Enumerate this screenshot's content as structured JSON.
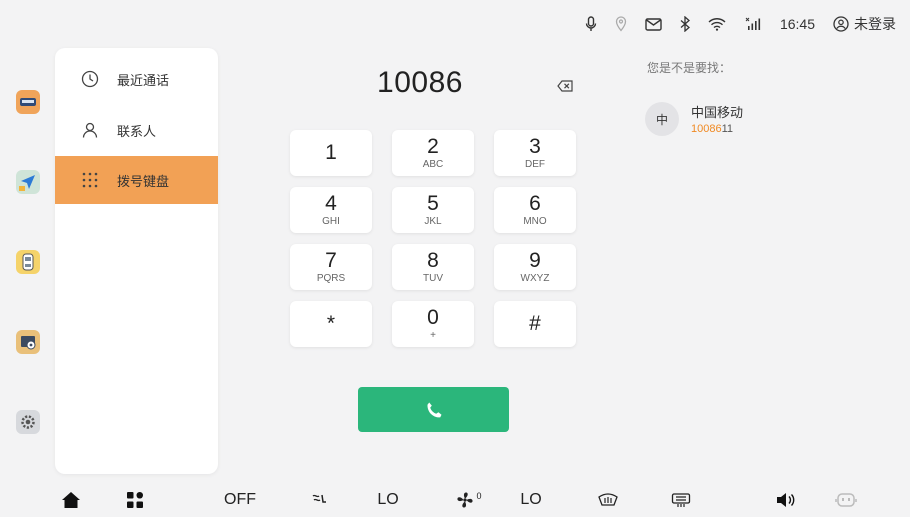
{
  "status_bar": {
    "time": "16:45",
    "user_label": "未登录",
    "icons": [
      "microphone-icon",
      "location-icon",
      "message-icon",
      "bluetooth-icon",
      "wifi-icon",
      "signal-icon",
      "user-icon"
    ]
  },
  "left_rail": {
    "apps": [
      "car-app-icon",
      "navigation-app-icon",
      "vehicle-app-icon",
      "media-app-icon",
      "settings-app-icon"
    ]
  },
  "sidebar": {
    "items": [
      {
        "label": "最近通话",
        "icon": "clock-icon",
        "active": false
      },
      {
        "label": "联系人",
        "icon": "person-icon",
        "active": false
      },
      {
        "label": "拨号键盘",
        "icon": "dialpad-icon",
        "active": true
      }
    ]
  },
  "dialer": {
    "number": "10086",
    "keys": [
      {
        "digit": "1",
        "letters": ""
      },
      {
        "digit": "2",
        "letters": "ABC"
      },
      {
        "digit": "3",
        "letters": "DEF"
      },
      {
        "digit": "4",
        "letters": "GHI"
      },
      {
        "digit": "5",
        "letters": "JKL"
      },
      {
        "digit": "6",
        "letters": "MNO"
      },
      {
        "digit": "7",
        "letters": "PQRS"
      },
      {
        "digit": "8",
        "letters": "TUV"
      },
      {
        "digit": "9",
        "letters": "WXYZ"
      },
      {
        "digit": "*",
        "letters": ""
      },
      {
        "digit": "0",
        "letters": "+"
      },
      {
        "digit": "#",
        "letters": ""
      }
    ]
  },
  "suggestions": {
    "title": "您是不是要找：",
    "items": [
      {
        "avatar": "中",
        "name": "中国移动",
        "number_match": "10086",
        "number_rest": "11"
      }
    ]
  },
  "bottom_bar": {
    "ac_state": "OFF",
    "temp_left": "LO",
    "fan_level": "0",
    "temp_right": "LO"
  },
  "colors": {
    "accent": "#f2a155",
    "call_green": "#2bb67b",
    "match_orange": "#f08a24"
  }
}
